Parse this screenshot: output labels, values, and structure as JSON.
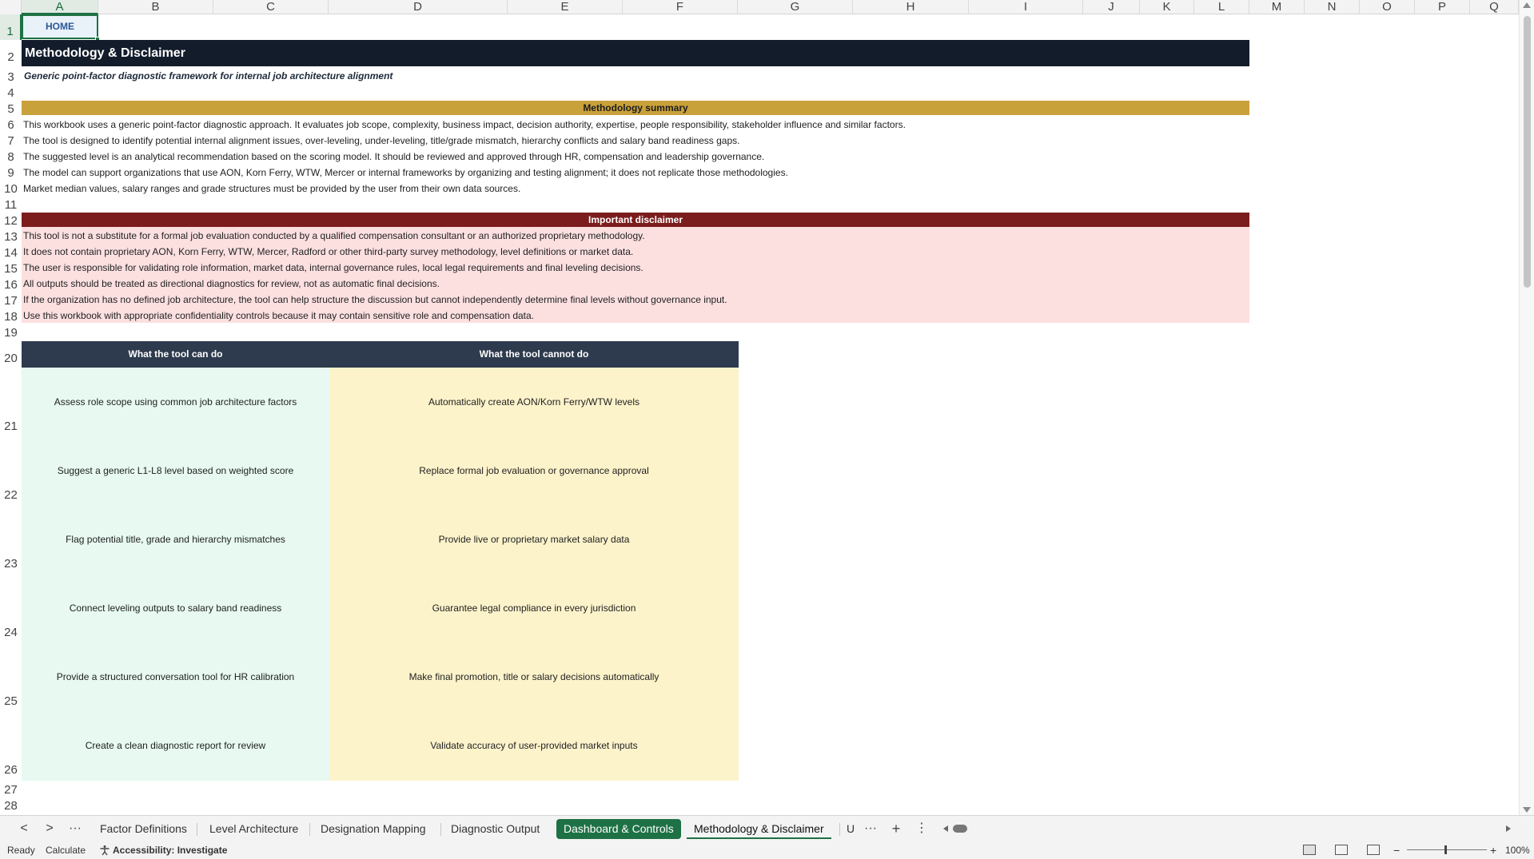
{
  "columns": [
    "A",
    "B",
    "C",
    "D",
    "E",
    "F",
    "G",
    "H",
    "I",
    "J",
    "K",
    "L",
    "M",
    "N",
    "O",
    "P",
    "Q"
  ],
  "rows": [
    "1",
    "2",
    "3",
    "4",
    "5",
    "6",
    "7",
    "8",
    "9",
    "10",
    "11",
    "12",
    "13",
    "14",
    "15",
    "16",
    "17",
    "18",
    "19",
    "20",
    "21",
    "22",
    "23",
    "24",
    "25",
    "26",
    "27",
    "28"
  ],
  "sheet": {
    "home_label": "HOME",
    "title": "Methodology & Disclaimer",
    "subtitle": "Generic point-factor diagnostic framework for internal job architecture alignment",
    "methodology_header": "Methodology summary",
    "methodology_lines": [
      "This workbook uses a generic point-factor diagnostic approach. It evaluates job scope, complexity, business impact, decision authority, expertise, people responsibility, stakeholder influence and similar factors.",
      "The tool is designed to identify potential internal alignment issues, over-leveling, under-leveling, title/grade mismatch, hierarchy conflicts and salary band readiness gaps.",
      "The suggested level is an analytical recommendation based on the scoring model. It should be reviewed and approved through HR, compensation and leadership governance.",
      "The model can support organizations that use AON, Korn Ferry, WTW, Mercer or internal frameworks by organizing and testing alignment; it does not replicate those methodologies.",
      "Market median values, salary ranges and grade structures must be provided by the user from their own data sources."
    ],
    "disclaimer_header": "Important disclaimer",
    "disclaimer_lines": [
      "This tool is not a substitute for a formal job evaluation conducted by a qualified compensation consultant or an authorized proprietary methodology.",
      "It does not contain proprietary AON, Korn Ferry, WTW, Mercer, Radford or other third-party survey methodology, level definitions or market data.",
      "The user is responsible for validating role information, market data, internal governance rules, local legal requirements and final leveling decisions.",
      "All outputs should be treated as directional diagnostics for review, not as automatic final decisions.",
      "If the organization has no defined job architecture, the tool can help structure the discussion but cannot independently determine final levels without governance input.",
      "Use this workbook with appropriate confidentiality controls because it may contain sensitive role and compensation data."
    ],
    "can_header": "What the tool can do",
    "cannot_header": "What the tool cannot do",
    "can_items": [
      "Assess role scope using common job architecture factors",
      "Suggest a generic L1-L8 level based on weighted score",
      "Flag potential title, grade and hierarchy mismatches",
      "Connect leveling outputs to salary band readiness",
      "Provide a structured conversation tool for HR calibration",
      "Create a clean diagnostic report for review"
    ],
    "cannot_items": [
      "Automatically create AON/Korn Ferry/WTW levels",
      "Replace formal job evaluation or governance approval",
      "Provide live or proprietary market salary data",
      "Guarantee legal compliance in every jurisdiction",
      "Make final promotion, title or salary decisions automatically",
      "Validate accuracy of user-provided market inputs"
    ]
  },
  "tabs": {
    "nav_prev": "<",
    "nav_next": ">",
    "more": "···",
    "items": [
      "Factor Definitions",
      "Level Architecture",
      "Designation Mapping",
      "Diagnostic Output",
      "Dashboard & Controls",
      "Methodology & Disclaimer"
    ],
    "overflow": "U",
    "overflow_more": "···",
    "add": "+",
    "options": "⋮"
  },
  "status": {
    "ready": "Ready",
    "calculate": "Calculate",
    "accessibility": "Accessibility: Investigate",
    "zoom_minus": "−",
    "zoom_plus": "+",
    "zoom": "100%"
  },
  "colors": {
    "title_bg": "#131c2b",
    "methodology_band": "#c9a13b",
    "disclaimer_band": "#7b1d1d",
    "disclaimer_bg": "#fce0e0",
    "table_header": "#2e3b4e",
    "can_bg": "#e7f9f1",
    "cannot_bg": "#fdf3cb",
    "active_tab": "#1e7145"
  }
}
